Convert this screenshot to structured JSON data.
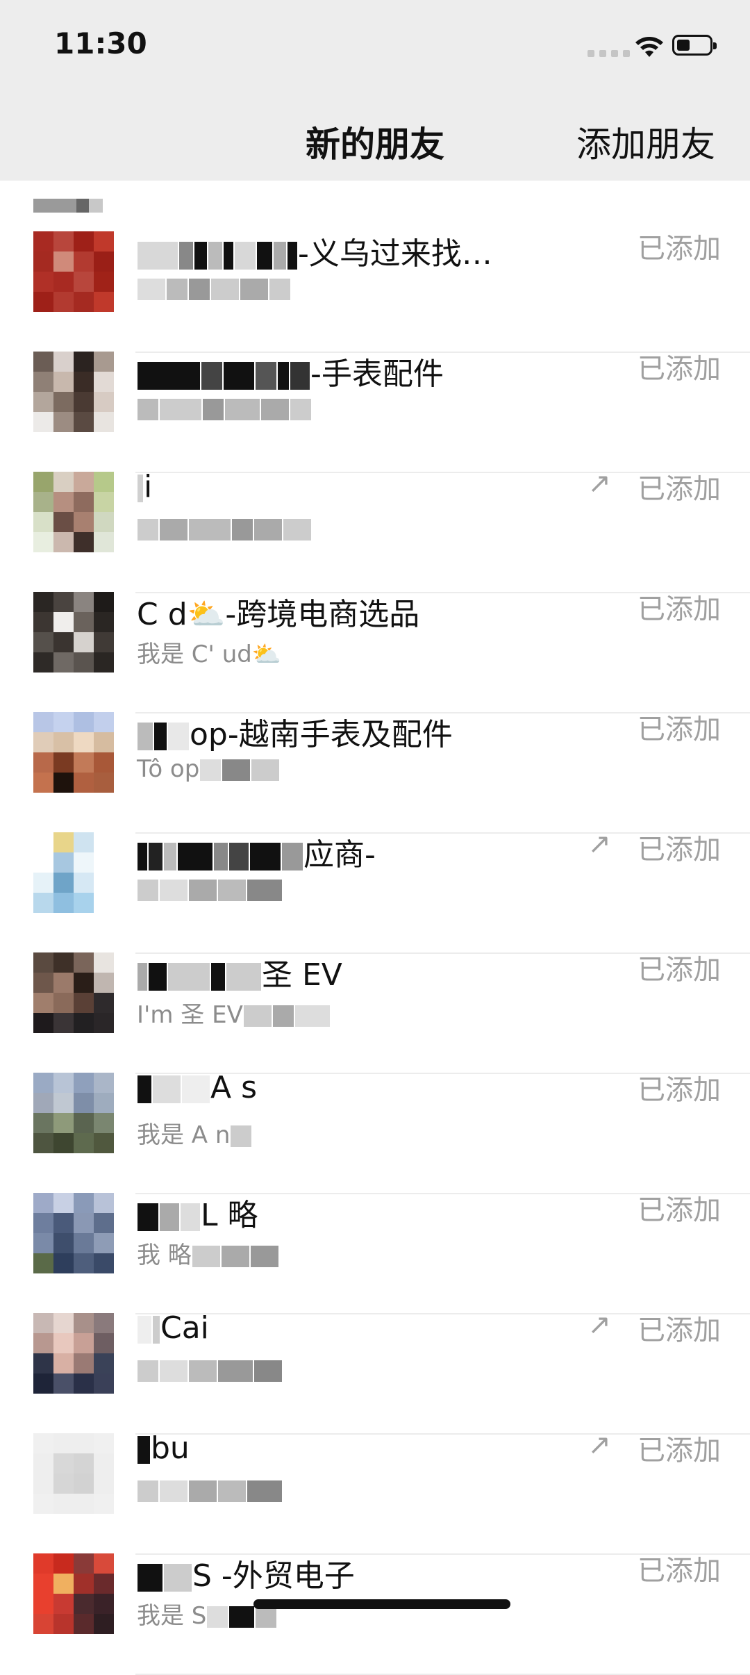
{
  "status_bar": {
    "time": "11:30"
  },
  "header": {
    "title": "新的朋友",
    "action": "添加朋友"
  },
  "friends": [
    {
      "name": "-义乌过来找…",
      "subtitle": "",
      "status": "已添加",
      "shared": false
    },
    {
      "name": "-手表配件",
      "subtitle": "",
      "status": "已添加",
      "shared": false
    },
    {
      "name": "i",
      "subtitle": "",
      "status": "已添加",
      "shared": true
    },
    {
      "name": "C d⛅-跨境电商选品",
      "subtitle": "我是 C' ud⛅",
      "status": "已添加",
      "shared": false
    },
    {
      "name": "op-越南手表及配件",
      "subtitle": "Tô op",
      "status": "已添加",
      "shared": false
    },
    {
      "name": "应商-",
      "subtitle": "",
      "status": "已添加",
      "shared": true
    },
    {
      "name": "圣 EV",
      "subtitle": "I'm 圣 EV",
      "status": "已添加",
      "shared": false
    },
    {
      "name": "A s",
      "subtitle": "我是 A n",
      "status": "已添加",
      "shared": false
    },
    {
      "name": "L 略",
      "subtitle": "我 略",
      "status": "已添加",
      "shared": false
    },
    {
      "name": "Cai",
      "subtitle": "",
      "status": "已添加",
      "shared": true
    },
    {
      "name": "bu",
      "subtitle": "",
      "status": "已添加",
      "shared": true
    },
    {
      "name": "S -外贸电子",
      "subtitle": "我是 S",
      "status": "已添加",
      "shared": false
    }
  ],
  "icons": {
    "share": "share-arrow-icon",
    "wifi": "wifi-icon",
    "battery": "battery-icon"
  }
}
